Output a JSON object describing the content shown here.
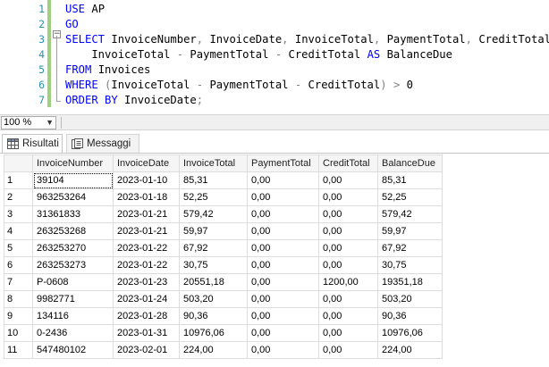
{
  "editor": {
    "line_numbers": [
      "1",
      "2",
      "3",
      "4",
      "5",
      "6",
      "7"
    ],
    "lines": [
      [
        {
          "t": "USE",
          "c": "kw"
        },
        {
          "t": " AP",
          "c": "fn"
        }
      ],
      [
        {
          "t": "GO",
          "c": "kw"
        }
      ],
      [
        {
          "t": "SELECT",
          "c": "kw"
        },
        {
          "t": " InvoiceNumber",
          "c": "fn"
        },
        {
          "t": ",",
          "c": "op"
        },
        {
          "t": " InvoiceDate",
          "c": "fn"
        },
        {
          "t": ",",
          "c": "op"
        },
        {
          "t": " InvoiceTotal",
          "c": "fn"
        },
        {
          "t": ",",
          "c": "op"
        },
        {
          "t": " PaymentTotal",
          "c": "fn"
        },
        {
          "t": ",",
          "c": "op"
        },
        {
          "t": " CreditTotal",
          "c": "fn"
        },
        {
          "t": ",",
          "c": "op"
        }
      ],
      [
        {
          "t": "    InvoiceTotal ",
          "c": "fn"
        },
        {
          "t": "-",
          "c": "op"
        },
        {
          "t": " PaymentTotal ",
          "c": "fn"
        },
        {
          "t": "-",
          "c": "op"
        },
        {
          "t": " CreditTotal ",
          "c": "fn"
        },
        {
          "t": "AS",
          "c": "kw"
        },
        {
          "t": " BalanceDue",
          "c": "fn"
        }
      ],
      [
        {
          "t": "FROM",
          "c": "kw"
        },
        {
          "t": " Invoices",
          "c": "fn"
        }
      ],
      [
        {
          "t": "WHERE",
          "c": "kw"
        },
        {
          "t": " ",
          "c": "fn"
        },
        {
          "t": "(",
          "c": "op"
        },
        {
          "t": "InvoiceTotal ",
          "c": "fn"
        },
        {
          "t": "-",
          "c": "op"
        },
        {
          "t": " PaymentTotal ",
          "c": "fn"
        },
        {
          "t": "-",
          "c": "op"
        },
        {
          "t": " CreditTotal",
          "c": "fn"
        },
        {
          "t": ")",
          "c": "op"
        },
        {
          "t": " ",
          "c": "fn"
        },
        {
          "t": ">",
          "c": "op"
        },
        {
          "t": " 0",
          "c": "fn"
        }
      ],
      [
        {
          "t": "ORDER BY",
          "c": "kw"
        },
        {
          "t": " InvoiceDate",
          "c": "fn"
        },
        {
          "t": ";",
          "c": "op"
        }
      ]
    ]
  },
  "zoom": {
    "value": "100 %"
  },
  "tabs": {
    "results": "Risultati",
    "messages": "Messaggi"
  },
  "grid": {
    "columns": [
      "InvoiceNumber",
      "InvoiceDate",
      "InvoiceTotal",
      "PaymentTotal",
      "CreditTotal",
      "BalanceDue"
    ],
    "rows": [
      [
        "1",
        "39104",
        "2023-01-10",
        "85,31",
        "0,00",
        "0,00",
        "85,31"
      ],
      [
        "2",
        "963253264",
        "2023-01-18",
        "52,25",
        "0,00",
        "0,00",
        "52,25"
      ],
      [
        "3",
        "31361833",
        "2023-01-21",
        "579,42",
        "0,00",
        "0,00",
        "579,42"
      ],
      [
        "4",
        "263253268",
        "2023-01-21",
        "59,97",
        "0,00",
        "0,00",
        "59,97"
      ],
      [
        "5",
        "263253270",
        "2023-01-22",
        "67,92",
        "0,00",
        "0,00",
        "67,92"
      ],
      [
        "6",
        "263253273",
        "2023-01-22",
        "30,75",
        "0,00",
        "0,00",
        "30,75"
      ],
      [
        "7",
        "P-0608",
        "2023-01-23",
        "20551,18",
        "0,00",
        "1200,00",
        "19351,18"
      ],
      [
        "8",
        "9982771",
        "2023-01-24",
        "503,20",
        "0,00",
        "0,00",
        "503,20"
      ],
      [
        "9",
        "134116",
        "2023-01-28",
        "90,36",
        "0,00",
        "0,00",
        "90,36"
      ],
      [
        "10",
        "0-2436",
        "2023-01-31",
        "10976,06",
        "0,00",
        "0,00",
        "10976,06"
      ],
      [
        "11",
        "547480102",
        "2023-02-01",
        "224,00",
        "0,00",
        "0,00",
        "224,00"
      ]
    ]
  }
}
